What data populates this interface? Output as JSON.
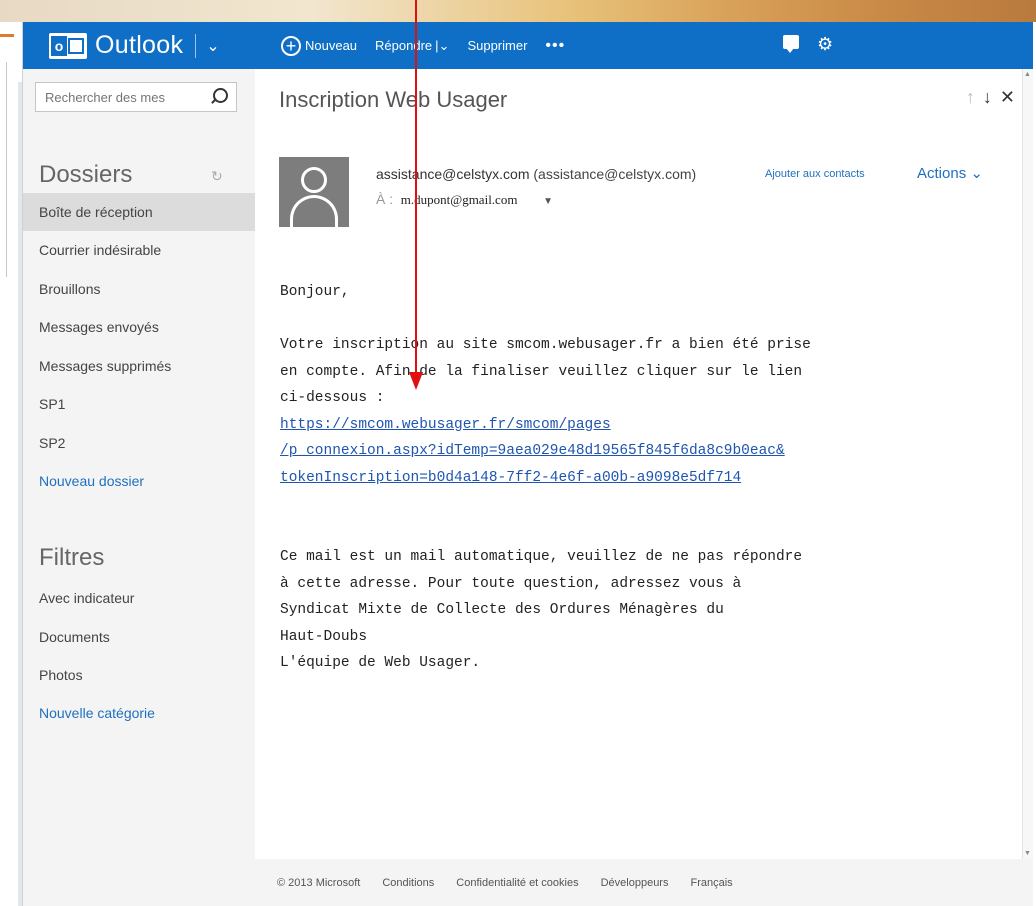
{
  "header": {
    "app_name": "Outlook",
    "commands": [
      {
        "label": "Nouveau"
      },
      {
        "label": "Répondre"
      },
      {
        "label": "Supprimer"
      },
      {
        "label": "•••"
      }
    ],
    "reply_chevron": "|⌄",
    "brand_chevron": "⌄"
  },
  "nav": {
    "search_placeholder": "Rechercher des mes",
    "folders_heading": "Dossiers",
    "folders": [
      {
        "label": "Boîte de réception",
        "active": true
      },
      {
        "label": "Courrier indésirable"
      },
      {
        "label": "Brouillons"
      },
      {
        "label": "Messages envoyés"
      },
      {
        "label": "Messages supprimés"
      },
      {
        "label": "SP1"
      },
      {
        "label": "SP2"
      },
      {
        "label": "Nouveau dossier"
      }
    ],
    "filters_heading": "Filtres",
    "filters": [
      {
        "label": "Avec indicateur"
      },
      {
        "label": "Documents"
      },
      {
        "label": "Photos"
      },
      {
        "label": "Nouvelle catégorie"
      }
    ]
  },
  "message": {
    "subject": "Inscription Web Usager",
    "from_name": "assistance@celstyx.com",
    "from_address": "(assistance@celstyx.com)",
    "add_to_contacts": "Ajouter aux contacts",
    "actions": "Actions ⌄",
    "to_label": "À :",
    "to_address": "m.dupont@gmail.com",
    "body_greeting": "Bonjour,",
    "body_para1_line1": "Votre inscription au site smcom.webusager.fr a bien été prise",
    "body_para1_line2": "en compte. Afin de la finaliser veuillez cliquer sur le lien",
    "body_para1_line3": "ci-dessous :",
    "link_line1": "https://smcom.webusager.fr/smcom/pages",
    "link_line2": "/p_connexion.aspx?idTemp=9aea029e48d19565f845f6da8c9b0eac&",
    "link_line3": "tokenInscription=b0d4a148-7ff2-4e6f-a00b-a9098e5df714",
    "body_para2_line1": "Ce mail est un mail automatique, veuillez de ne pas répondre",
    "body_para2_line2": "à cette adresse. Pour toute question, adressez vous à",
    "body_para2_line3": "Syndicat Mixte de Collecte des Ordures Ménagères du",
    "body_para2_line4": "Haut-Doubs",
    "body_signature": "L'équipe de Web Usager."
  },
  "footer": {
    "copyright": "© 2013 Microsoft",
    "links": [
      "Conditions",
      "Confidentialité et cookies",
      "Développeurs",
      "Français"
    ]
  },
  "colors": {
    "header_blue": "#0f6fc6",
    "link_blue": "#1f6fbf",
    "annotation_red": "#e01010"
  }
}
